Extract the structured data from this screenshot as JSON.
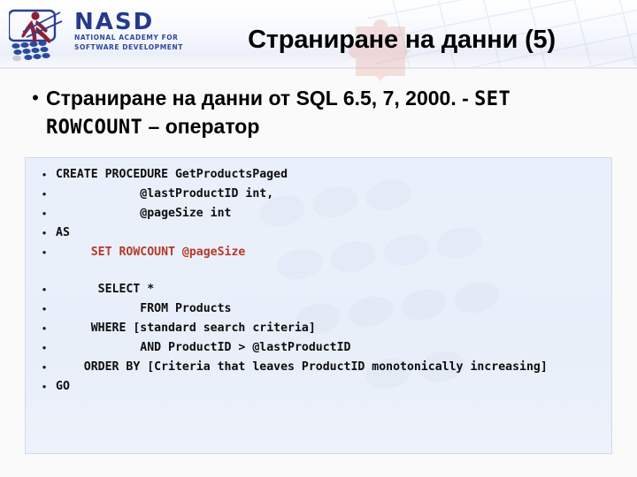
{
  "slide": {
    "title": "Страниране на данни (5)",
    "background_color": "#fafafa",
    "accent_color": "#b5392a"
  },
  "logo": {
    "acronym": "NASD",
    "subtitle_line1": "NATIONAL ACADEMY FOR",
    "subtitle_line2": "SOFTWARE DEVELOPMENT",
    "mark_icon": "nasd-figure-icon",
    "brand_color": "#253a8c"
  },
  "header": {
    "watermark_icon": "keyboard-grid-watermark",
    "puzzle_icon": "puzzle-piece-watermark"
  },
  "lead": {
    "bullet": "•",
    "text_before": "Страниране на данни от SQL 6.5, 7, 2000. - ",
    "mono": "SET ROWCOUNT",
    "text_after": " – оператор"
  },
  "code": {
    "bullet": "•",
    "watermark_icon": "keyboard-watermark",
    "lines": [
      {
        "text": "CREATE PROCEDURE GetProductsPaged",
        "accent": false,
        "gap": false
      },
      {
        "text": "            @lastProductID int,",
        "accent": false,
        "gap": false
      },
      {
        "text": "            @pageSize int",
        "accent": false,
        "gap": false
      },
      {
        "text": "AS",
        "accent": false,
        "gap": false
      },
      {
        "text": "     SET ROWCOUNT @pageSize",
        "accent": true,
        "gap": false
      },
      {
        "text": "      SELECT *",
        "accent": false,
        "gap": true
      },
      {
        "text": "            FROM Products",
        "accent": false,
        "gap": false
      },
      {
        "text": "     WHERE [standard search criteria]",
        "accent": false,
        "gap": false
      },
      {
        "text": "            AND ProductID > @lastProductID",
        "accent": false,
        "gap": false
      },
      {
        "text": "    ORDER BY [Criteria that leaves ProductID monotonically increasing]",
        "accent": false,
        "gap": false
      },
      {
        "text": "GO",
        "accent": false,
        "gap": false
      }
    ]
  }
}
